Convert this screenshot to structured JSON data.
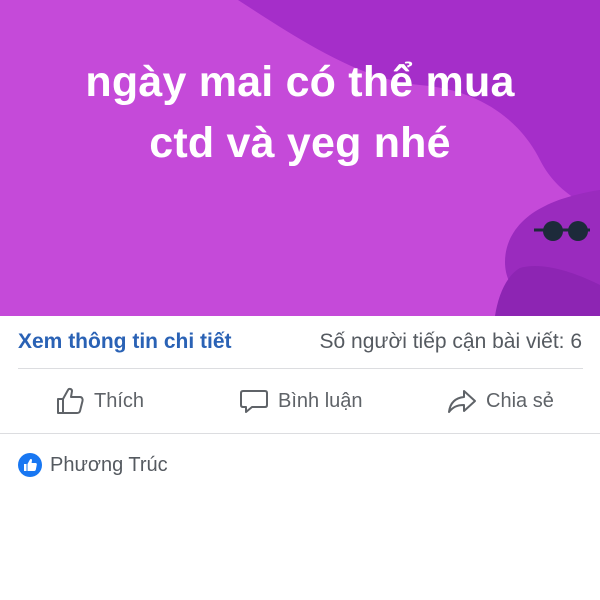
{
  "post": {
    "background_color": "#c54ad9",
    "text_color": "#ffffff",
    "status_line_1": "ngày mai có thể mua",
    "status_line_2": "ctd và yeg nhé"
  },
  "info_bar": {
    "details_link": "Xem thông tin chi tiết",
    "reach_text": "Số người tiếp cận bài viết: 6"
  },
  "actions": {
    "like_label": "Thích",
    "comment_label": "Bình luận",
    "share_label": "Chia sẻ"
  },
  "reactions": {
    "reactor_name": "Phương Trúc",
    "badge_color": "#1877f2",
    "badge_icon": "thumbs-up-icon"
  },
  "colors": {
    "link_blue": "#2a62b5",
    "secondary_text": "#555a60",
    "divider": "#dcdde0"
  }
}
